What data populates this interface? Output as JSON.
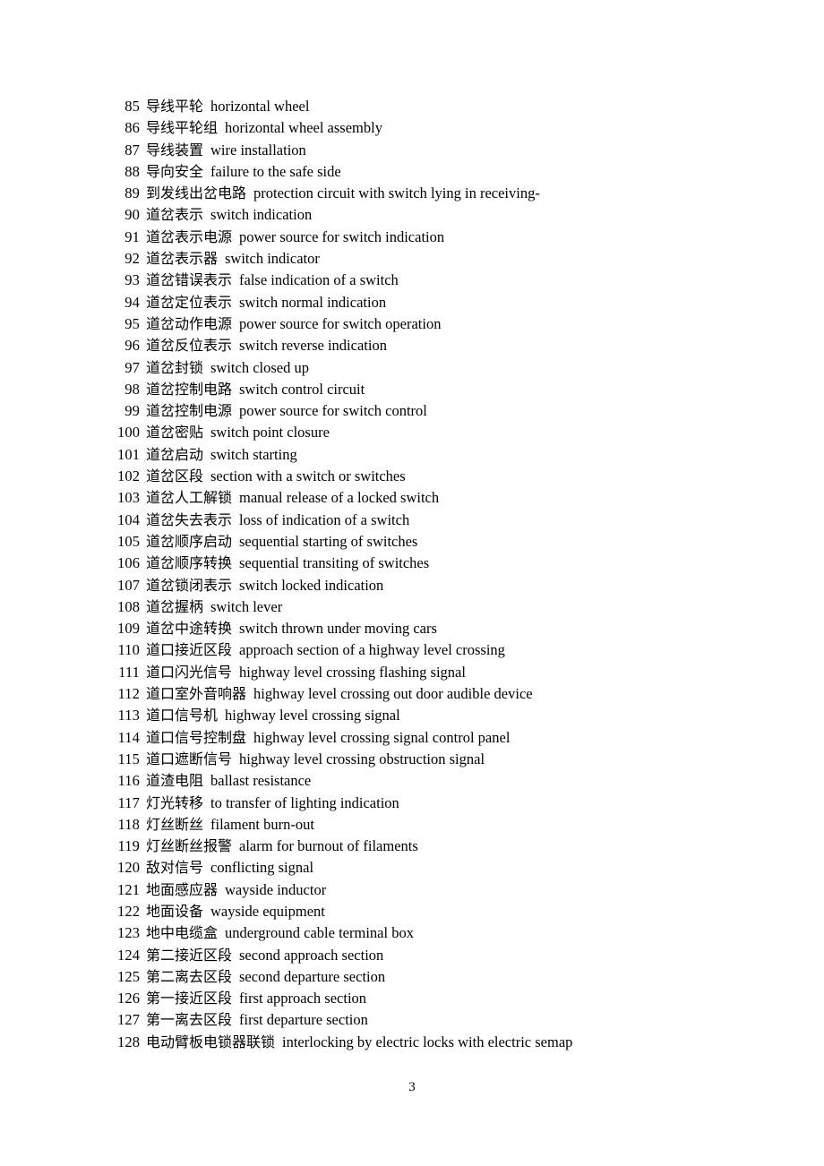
{
  "document": {
    "page_number": "3",
    "entries": [
      {
        "num": "85",
        "zh": "导线平轮",
        "en": "horizontal wheel"
      },
      {
        "num": "86",
        "zh": "导线平轮组",
        "en": "horizontal wheel assembly"
      },
      {
        "num": "87",
        "zh": "导线装置",
        "en": "wire installation"
      },
      {
        "num": "88",
        "zh": "导向安全",
        "en": "failure to the safe side"
      },
      {
        "num": "89",
        "zh": "到发线出岔电路",
        "en": "protection circuit with switch lying in receiving-"
      },
      {
        "num": "90",
        "zh": "道岔表示",
        "en": "switch indication"
      },
      {
        "num": "91",
        "zh": "道岔表示电源",
        "en": "power source for switch indication"
      },
      {
        "num": "92",
        "zh": "道岔表示器",
        "en": "switch indicator"
      },
      {
        "num": "93",
        "zh": "道岔错误表示",
        "en": "false indication of a switch"
      },
      {
        "num": "94",
        "zh": "道岔定位表示",
        "en": "switch normal indication"
      },
      {
        "num": "95",
        "zh": "道岔动作电源",
        "en": "power source for switch operation"
      },
      {
        "num": "96",
        "zh": "道岔反位表示",
        "en": "switch reverse indication"
      },
      {
        "num": "97",
        "zh": "道岔封锁",
        "en": "switch closed up"
      },
      {
        "num": "98",
        "zh": "道岔控制电路",
        "en": "switch control circuit"
      },
      {
        "num": "99",
        "zh": "道岔控制电源",
        "en": "power source for switch control"
      },
      {
        "num": "100",
        "zh": "道岔密贴",
        "en": "switch point closure"
      },
      {
        "num": "101",
        "zh": "道岔启动",
        "en": "switch starting"
      },
      {
        "num": "102",
        "zh": "道岔区段",
        "en": "section with a switch or switches"
      },
      {
        "num": "103",
        "zh": "道岔人工解锁",
        "en": "manual release of a locked switch"
      },
      {
        "num": "104",
        "zh": "道岔失去表示",
        "en": "loss of indication of a switch"
      },
      {
        "num": "105",
        "zh": "道岔顺序启动",
        "en": "sequential starting of switches"
      },
      {
        "num": "106",
        "zh": "道岔顺序转换",
        "en": "sequential transiting of switches"
      },
      {
        "num": "107",
        "zh": "道岔锁闭表示",
        "en": "switch locked indication"
      },
      {
        "num": "108",
        "zh": "道岔握柄",
        "en": "switch lever"
      },
      {
        "num": "109",
        "zh": "道岔中途转换",
        "en": "switch thrown under moving cars"
      },
      {
        "num": "110",
        "zh": "道口接近区段",
        "en": "approach section of a highway level crossing"
      },
      {
        "num": "111",
        "zh": "道口闪光信号",
        "en": "highway level crossing flashing signal"
      },
      {
        "num": "112",
        "zh": "道口室外音响器",
        "en": "highway level crossing out door audible device"
      },
      {
        "num": "113",
        "zh": "道口信号机",
        "en": "highway level crossing signal"
      },
      {
        "num": "114",
        "zh": "道口信号控制盘",
        "en": "highway level crossing signal control panel"
      },
      {
        "num": "115",
        "zh": "道口遮断信号",
        "en": "highway level crossing obstruction signal"
      },
      {
        "num": "116",
        "zh": "道渣电阻",
        "en": "ballast resistance"
      },
      {
        "num": "117",
        "zh": "灯光转移",
        "en": "to transfer of lighting indication"
      },
      {
        "num": "118",
        "zh": "灯丝断丝",
        "en": "filament burn-out"
      },
      {
        "num": "119",
        "zh": "灯丝断丝报警",
        "en": "alarm for burnout of filaments"
      },
      {
        "num": "120",
        "zh": "敌对信号",
        "en": "conflicting signal"
      },
      {
        "num": "121",
        "zh": "地面感应器",
        "en": "wayside inductor"
      },
      {
        "num": "122",
        "zh": "地面设备",
        "en": "wayside equipment"
      },
      {
        "num": "123",
        "zh": "地中电缆盒",
        "en": "underground cable terminal box"
      },
      {
        "num": "124",
        "zh": "第二接近区段",
        "en": "second approach section"
      },
      {
        "num": "125",
        "zh": "第二离去区段",
        "en": "second departure section"
      },
      {
        "num": "126",
        "zh": "第一接近区段",
        "en": "first approach section"
      },
      {
        "num": "127",
        "zh": "第一离去区段",
        "en": "first departure section"
      },
      {
        "num": "128",
        "zh": "电动臂板电锁器联锁",
        "en": "interlocking by electric locks with electric semap"
      }
    ]
  }
}
